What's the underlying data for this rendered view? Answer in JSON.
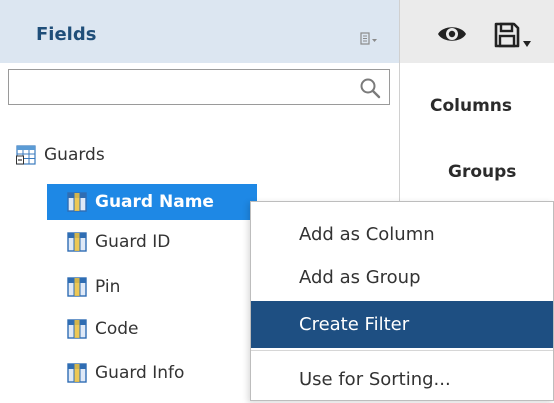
{
  "fields_panel": {
    "title": "Fields",
    "search": {
      "value": "",
      "placeholder": ""
    },
    "tree": {
      "root_label": "Guards",
      "items": [
        {
          "label": "Guard Name",
          "selected": true
        },
        {
          "label": "Guard ID",
          "selected": false
        },
        {
          "label": "Pin",
          "selected": false
        },
        {
          "label": "Code",
          "selected": false
        },
        {
          "label": "Guard Info",
          "selected": false
        }
      ]
    }
  },
  "right_panel": {
    "columns_label": "Columns",
    "groups_label": "Groups"
  },
  "context_menu": {
    "items": [
      {
        "label": "Add as Column"
      },
      {
        "label": "Add as Group"
      },
      {
        "label": "Create Filter",
        "highlighted": true
      },
      {
        "label": "Use for Sorting..."
      }
    ]
  },
  "colors": {
    "header_bg": "#dce6f1",
    "title_color": "#1f4e79",
    "selection_blue": "#1e88e5",
    "menu_highlight": "#1e4f82",
    "toolbar_bg": "#ebebeb"
  },
  "icons": [
    "list-menu-icon",
    "search-icon",
    "table-icon",
    "field-icon",
    "eye-icon",
    "save-icon",
    "chevron-down-icon"
  ]
}
